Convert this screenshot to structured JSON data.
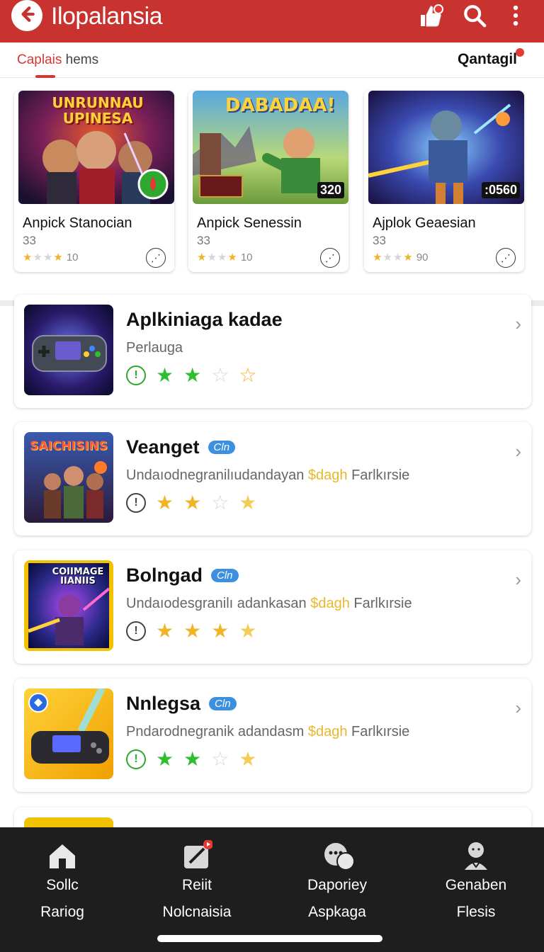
{
  "appbar": {
    "title": "Ilopalansia",
    "back_icon": "arrow-left-icon",
    "action_icons": [
      "thumbs-up-notification-icon",
      "search-icon",
      "more-vert-icon"
    ]
  },
  "tabs": {
    "active_part1": "Caplais",
    "active_part2": " hems",
    "right_label": "Qantagil"
  },
  "featured": [
    {
      "title": "Anpick Stanocian",
      "subtitle": "33",
      "rating_text": "10",
      "stars_filled": 3,
      "badge": "",
      "thumb_text": "UNRUNNAU UPINESA"
    },
    {
      "title": "Anpick Senessin",
      "subtitle": "33",
      "rating_text": "10",
      "stars_filled": 3,
      "badge": "320",
      "thumb_text": "DABADAA!"
    },
    {
      "title": "Ajplok Geaesian",
      "subtitle": "33",
      "rating_text": "90",
      "stars_filled": 3,
      "badge": ":0560",
      "thumb_text": ""
    }
  ],
  "list": [
    {
      "title": "Aplkiniaga kadae",
      "badge": "",
      "desc": "Perlauga",
      "desc_gold": "",
      "desc_tail": "",
      "star_color": "green",
      "stars": [
        "green",
        "green",
        "empty",
        "outline-gold"
      ]
    },
    {
      "title": "Veanget",
      "badge": "Cln",
      "desc": "Undaıodnegranilıudandayan",
      "desc_gold": "$dagh",
      "desc_tail": "Farlkırsie",
      "star_color": "gold",
      "stars": [
        "gold",
        "gold",
        "empty",
        "gold-light"
      ],
      "thumb_text": "SAICHISINS"
    },
    {
      "title": "Bolngad",
      "badge": "Cln",
      "desc": "Undaıodesgranilı adankasan",
      "desc_gold": "$dagh",
      "desc_tail": "Farlkırsie",
      "star_color": "gold",
      "stars": [
        "gold",
        "gold",
        "gold",
        "gold-light"
      ],
      "thumb_text": "COIIMAGE IIANIIS"
    },
    {
      "title": "Nnlegsa",
      "badge": "Cln",
      "desc": "Pndarodnegranik adandasm",
      "desc_gold": "$dagh",
      "desc_tail": "Farlkırsie",
      "star_color": "green",
      "stars": [
        "green",
        "green",
        "empty",
        "gold-light"
      ]
    }
  ],
  "bottomnav": [
    {
      "l1": "Sollc",
      "l2": "Rariog",
      "icon": "home-icon"
    },
    {
      "l1": "Reiit",
      "l2": "Nolcnaisia",
      "icon": "edit-notification-icon"
    },
    {
      "l1": "Daporiey",
      "l2": "Aspkaga",
      "icon": "chat-bubbles-icon"
    },
    {
      "l1": "Genaben",
      "l2": "Flesis",
      "icon": "profile-icon"
    }
  ],
  "colors": {
    "brand_red": "#c8322f",
    "accent_blue": "#3d8fe0",
    "star_gold": "#f0b429",
    "star_green": "#2ebf2e",
    "nav_bg": "#1e1e1e"
  }
}
